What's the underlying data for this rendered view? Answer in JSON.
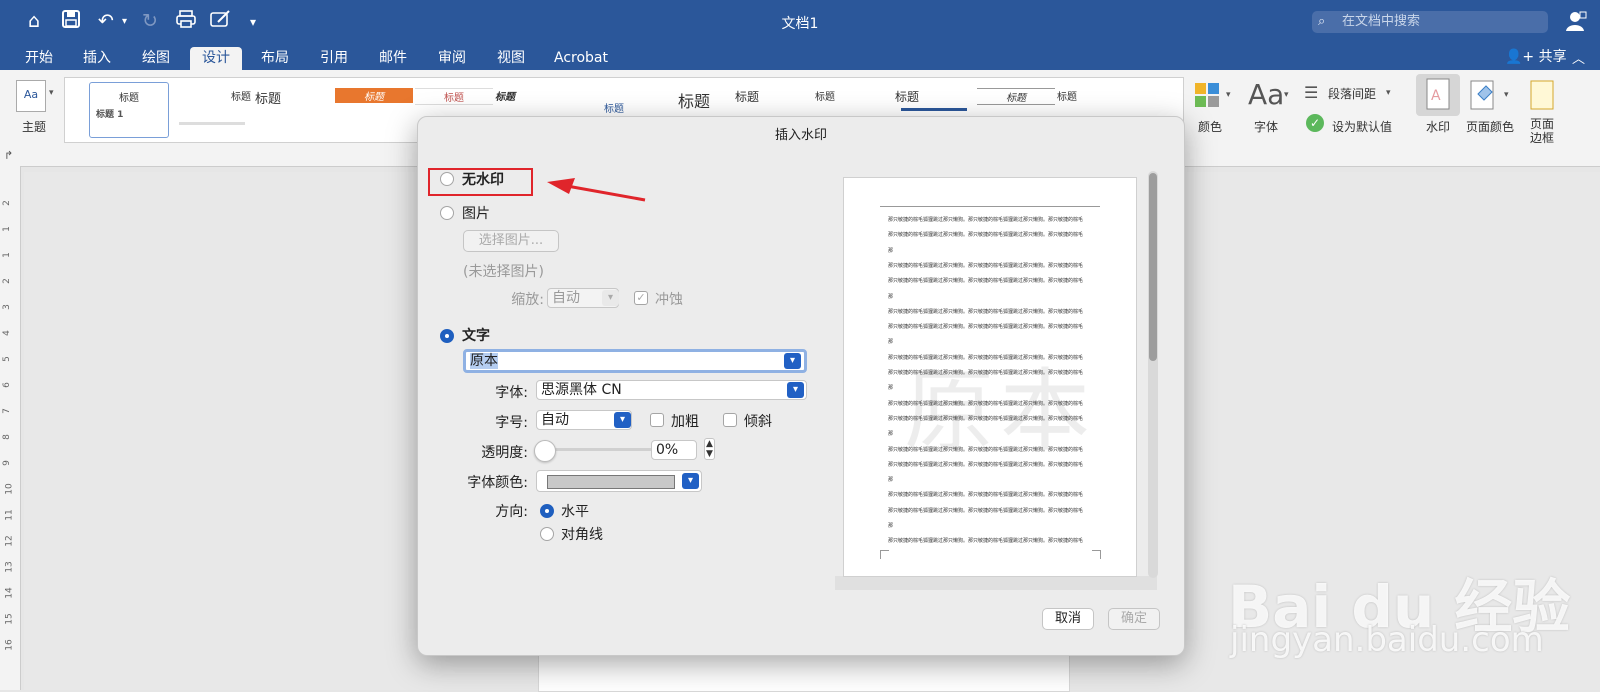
{
  "titlebar": {
    "doc_title": "文档1",
    "search_placeholder": "在文档中搜索"
  },
  "tabs": [
    {
      "label": "开始"
    },
    {
      "label": "插入"
    },
    {
      "label": "绘图"
    },
    {
      "label": "设计"
    },
    {
      "label": "布局"
    },
    {
      "label": "引用"
    },
    {
      "label": "邮件"
    },
    {
      "label": "审阅"
    },
    {
      "label": "视图"
    },
    {
      "label": "Acrobat"
    }
  ],
  "share_label": "共享",
  "ribbon": {
    "theme_label": "主题",
    "color_label": "颜色",
    "font_label": "字体",
    "para_spacing_label": "段落间距",
    "set_default_label": "设为默认值",
    "watermark_label": "水印",
    "page_color_label": "页面颜色",
    "page_border_label": "页面\n边框",
    "gallery": [
      "标题",
      "标题",
      "标题",
      "标题",
      "标题",
      "标题",
      "标题",
      "标题",
      "标题",
      "标题",
      "标题",
      "标题",
      "标题",
      "标题"
    ],
    "gallery_sub": "标题 1"
  },
  "dialog": {
    "title": "插入水印",
    "no_watermark": "无水印",
    "picture": "图片",
    "select_picture": "选择图片...",
    "no_picture_selected": "(未选择图片)",
    "scale_label": "缩放:",
    "scale_value": "自动",
    "washout_label": "冲蚀",
    "text_option": "文字",
    "text_value": "原本",
    "font_label": "字体:",
    "font_value": "思源黑体 CN",
    "size_label": "字号:",
    "size_value": "自动",
    "bold_label": "加粗",
    "italic_label": "倾斜",
    "transparency_label": "透明度:",
    "transparency_value": "0%",
    "transparency_fraction": 0,
    "font_color_label": "字体颜色:",
    "font_color": "#c8c8c8",
    "direction_label": "方向:",
    "horizontal_label": "水平",
    "diagonal_label": "对角线",
    "cancel_label": "取消",
    "ok_label": "确定",
    "preview_line_text": "那只敏捷的棕毛狐狸跳过那只懒狗。那只敏捷的棕毛狐狸跳过那只懒狗。那只敏捷的棕毛",
    "preview_watermark": "原本"
  },
  "colors": {
    "accent": "#2b579a",
    "highlight_box": "#e0252b",
    "arrow": "#e0252b"
  },
  "baidu": {
    "logo": "Bai du 经验",
    "url": "jingyan.baidu.com"
  }
}
